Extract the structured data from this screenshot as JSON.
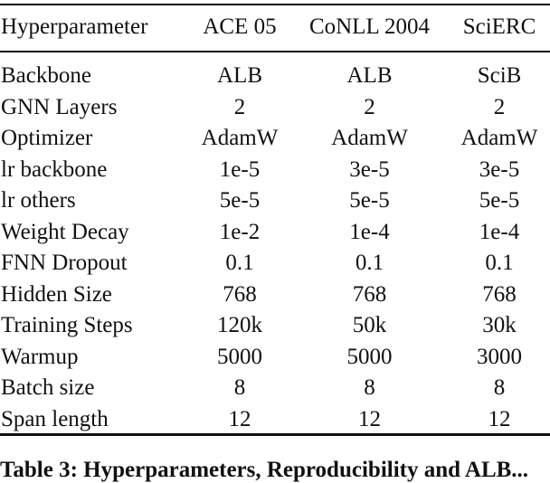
{
  "table": {
    "headers": [
      "Hyperparameter",
      "ACE 05",
      "CoNLL 2004",
      "SciERC"
    ],
    "rows": [
      [
        "Backbone",
        "ALB",
        "ALB",
        "SciB"
      ],
      [
        "GNN Layers",
        "2",
        "2",
        "2"
      ],
      [
        "Optimizer",
        "AdamW",
        "AdamW",
        "AdamW"
      ],
      [
        "lr backbone",
        "1e-5",
        "3e-5",
        "3e-5"
      ],
      [
        "lr others",
        "5e-5",
        "5e-5",
        "5e-5"
      ],
      [
        "Weight Decay",
        "1e-2",
        "1e-4",
        "1e-4"
      ],
      [
        "FNN Dropout",
        "0.1",
        "0.1",
        "0.1"
      ],
      [
        "Hidden Size",
        "768",
        "768",
        "768"
      ],
      [
        "Training Steps",
        "120k",
        "50k",
        "30k"
      ],
      [
        "Warmup",
        "5000",
        "5000",
        "3000"
      ],
      [
        "Batch size",
        "8",
        "8",
        "8"
      ],
      [
        "Span length",
        "12",
        "12",
        "12"
      ]
    ]
  },
  "caption": "Table 3: Hyperparameters, Reproducibility and ALB..."
}
